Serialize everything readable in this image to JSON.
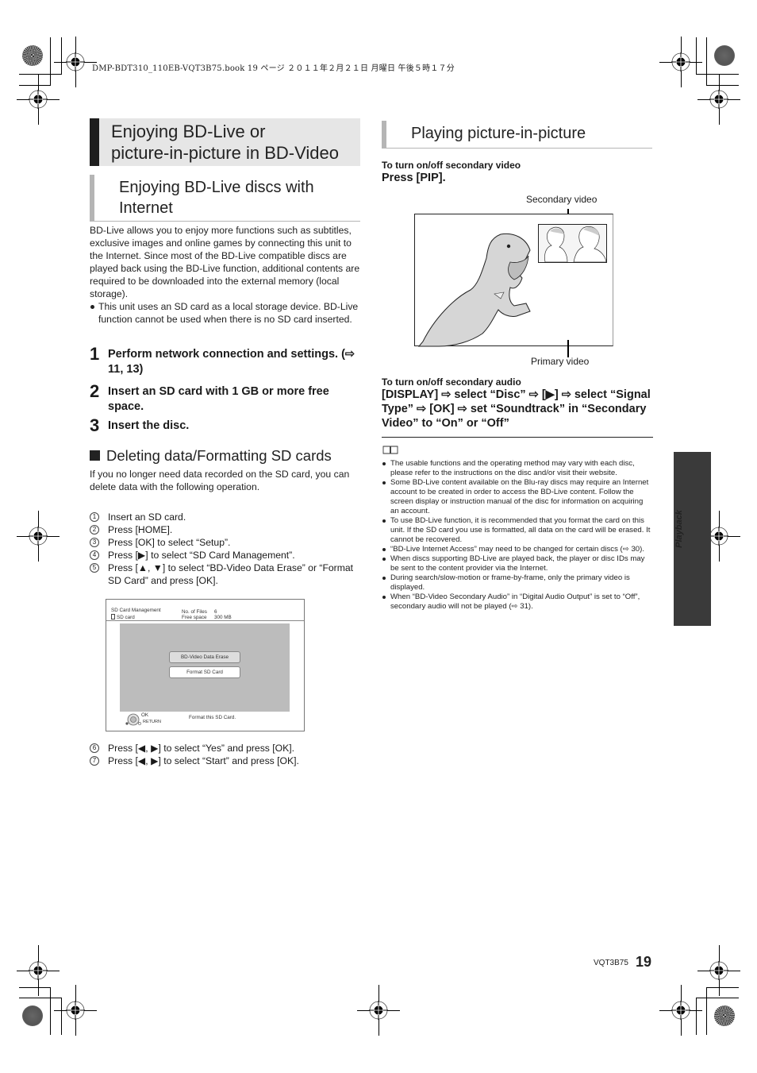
{
  "header_line": "DMP-BDT310_110EB-VQT3B75.book  19 ページ  ２０１１年２月２１日  月曜日  午後５時１７分",
  "left_column": {
    "main_title_line1": "Enjoying BD-Live or",
    "main_title_line2": "picture-in-picture in BD-Video",
    "section_title_line1": "Enjoying BD-Live discs with",
    "section_title_line2": "Internet",
    "intro": "BD-Live allows you to enjoy more functions such as subtitles, exclusive images and online games by connecting this unit to the Internet. Since most of the BD-Live compatible discs are played back using the BD-Live function, additional contents are required to be downloaded into the external memory (local storage).",
    "intro_bullet": "This unit uses an SD card as a local storage device. BD-Live function cannot be used when there is no SD card inserted.",
    "steps": [
      {
        "num": "1",
        "text": "Perform network connection and settings. (⇨ 11, 13)"
      },
      {
        "num": "2",
        "text": "Insert an SD card with 1 GB or more free space."
      },
      {
        "num": "3",
        "text": "Insert the disc."
      }
    ],
    "delete_heading": "Deleting data/Formatting SD cards",
    "delete_intro": "If you no longer need data recorded on the SD card, you can delete data with the following operation.",
    "operations": [
      {
        "mark": "1",
        "text": "Insert an SD card."
      },
      {
        "mark": "2",
        "text": "Press [HOME]."
      },
      {
        "mark": "3",
        "text": "Press [OK] to select “Setup”."
      },
      {
        "mark": "4",
        "text": "Press [▶] to select “SD Card Management”."
      },
      {
        "mark": "5",
        "text": "Press [▲, ▼] to select “BD-Video Data Erase” or “Format SD Card” and press [OK]."
      }
    ],
    "operations_after": [
      {
        "mark": "6",
        "text": "Press [◀, ▶] to select “Yes” and press [OK]."
      },
      {
        "mark": "7",
        "text": "Press [◀, ▶] to select “Start” and press [OK]."
      }
    ],
    "sd_screen": {
      "title": "SD Card Management",
      "device": "SD card",
      "files_label": "No. of Files",
      "files_value": "6",
      "free_label": "Free space",
      "free_value": "300 MB",
      "options": [
        "BD-Video Data Erase",
        "Format SD Card"
      ],
      "selected_option": "Format SD Card",
      "ok_label": "OK",
      "return_label": "RETURN",
      "status": "Format this SD Card."
    }
  },
  "right_column": {
    "pip_title": "Playing picture-in-picture",
    "video_sub": "To turn on/off secondary video",
    "video_action": "Press [PIP].",
    "secondary_label": "Secondary video",
    "primary_label": "Primary video",
    "audio_sub": "To turn on/off secondary audio",
    "audio_action": "[DISPLAY] ⇨ select “Disc” ⇨ [▶] ⇨ select “Signal Type” ⇨ [OK] ⇨ set “Soundtrack” in “Secondary Video” to “On” or “Off”",
    "notes": [
      "The usable functions and the operating method may vary with each disc, please refer to the instructions on the disc and/or visit their website.",
      "Some BD-Live content available on the Blu-ray discs may require an Internet account to be created in order to access the BD-Live content. Follow the screen display or instruction manual of the disc for information on acquiring an account.",
      "To use BD-Live function, it is recommended that you format the card on this unit. If the SD card you use is formatted, all data on the card will be erased. It cannot be recovered.",
      "“BD-Live Internet Access” may need to be changed for certain discs (⇨ 30).",
      "When discs supporting BD-Live are played back, the player or disc IDs may be sent to the content provider via the Internet.",
      "During search/slow-motion or frame-by-frame, only the primary video is displayed.",
      "When “BD-Video Secondary Audio” in “Digital Audio Output” is set to “Off”, secondary audio will not be played (⇨ 31)."
    ]
  },
  "side_tab_label": "Playback",
  "footer": {
    "code": "VQT3B75",
    "page": "19"
  }
}
